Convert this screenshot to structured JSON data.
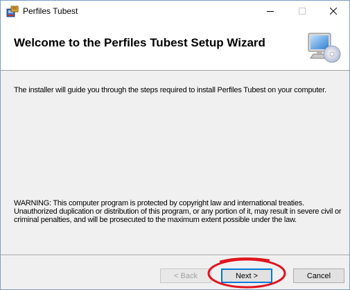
{
  "window": {
    "title": "Perfiles Tubest",
    "icons": {
      "app": "setup-installer-icon",
      "minimize": "minimize-icon",
      "maximize": "maximize-icon",
      "close": "close-icon"
    }
  },
  "banner": {
    "title": "Welcome to the Perfiles Tubest Setup Wizard",
    "icon": "computer-cd-icon"
  },
  "body": {
    "intro": "The installer will guide you through the steps required to install Perfiles Tubest on your computer.",
    "warning": "WARNING: This computer program is protected by copyright law and international treaties. Unauthorized duplication or distribution of this program, or any portion of it, may result in severe civil or criminal penalties, and will be prosecuted to the maximum extent possible under the law."
  },
  "buttons": {
    "back": "< Back",
    "next": "Next >",
    "cancel": "Cancel"
  },
  "colors": {
    "accent": "#0078d7",
    "highlight_annotation": "#e0141e",
    "window_bg": "#f0f0f0"
  }
}
